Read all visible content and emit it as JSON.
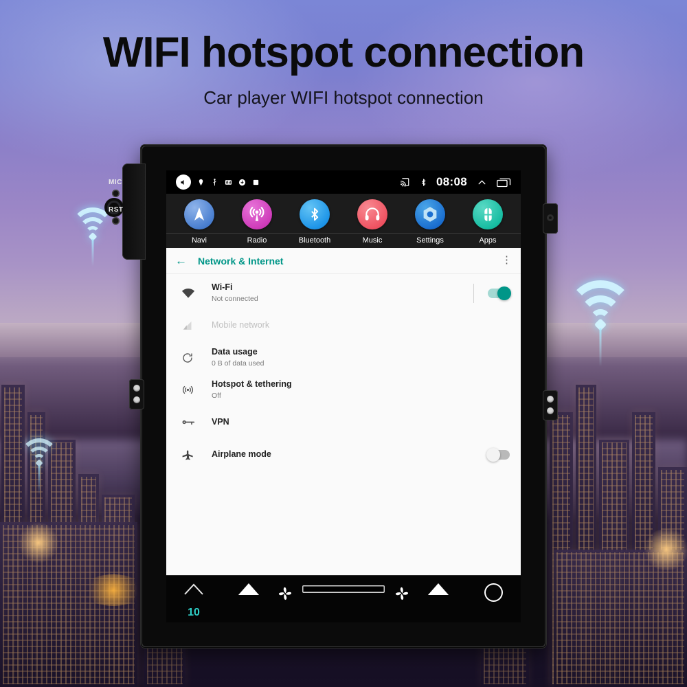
{
  "page": {
    "title": "WIFI hotspot connection",
    "subtitle": "Car player WIFI hotspot connection"
  },
  "device": {
    "left_ports": [
      {
        "label": "MIC",
        "icon": "microphone-jack-icon"
      },
      {
        "label": "RST",
        "icon": "reset-button-icon"
      }
    ]
  },
  "status_bar": {
    "left_icons": [
      "volume-mute-icon",
      "location-icon",
      "usb-icon",
      "equalizer-icon",
      "download-icon",
      "stop-square-icon"
    ],
    "right_icons": [
      "cast-icon",
      "bluetooth-icon"
    ],
    "time": "08:08",
    "chevron_icon": "chevron-up-icon",
    "recents_icon": "recents-icon"
  },
  "dock": {
    "items": [
      {
        "label": "Navi",
        "icon": "navigation-arrow-icon"
      },
      {
        "label": "Radio",
        "icon": "radio-antenna-icon"
      },
      {
        "label": "Bluetooth",
        "icon": "bluetooth-icon"
      },
      {
        "label": "Music",
        "icon": "headphones-icon"
      },
      {
        "label": "Settings",
        "icon": "settings-gear-icon"
      },
      {
        "label": "Apps",
        "icon": "apps-grid-icon"
      }
    ]
  },
  "settings": {
    "back_icon": "back-arrow-icon",
    "title": "Network & Internet",
    "overflow_icon": "more-vertical-icon",
    "rows": [
      {
        "id": "wifi",
        "icon": "wifi-icon",
        "title": "Wi-Fi",
        "subtitle": "Not connected",
        "control": "switch",
        "switch_state": "on",
        "disabled": false,
        "has_divider": true
      },
      {
        "id": "mobile-network",
        "icon": "signal-cellular-icon",
        "title": "Mobile network",
        "subtitle": "",
        "control": "none",
        "switch_state": "",
        "disabled": true,
        "has_divider": false
      },
      {
        "id": "data-usage",
        "icon": "data-usage-icon",
        "title": "Data usage",
        "subtitle": "0 B of data used",
        "control": "none",
        "switch_state": "",
        "disabled": false,
        "has_divider": false
      },
      {
        "id": "hotspot-tethering",
        "icon": "hotspot-icon",
        "title": "Hotspot & tethering",
        "subtitle": "Off",
        "control": "none",
        "switch_state": "",
        "disabled": false,
        "has_divider": false
      },
      {
        "id": "vpn",
        "icon": "vpn-key-icon",
        "title": "VPN",
        "subtitle": "",
        "control": "none",
        "switch_state": "",
        "disabled": false,
        "has_divider": false
      },
      {
        "id": "airplane-mode",
        "icon": "airplane-icon",
        "title": "Airplane mode",
        "subtitle": "",
        "control": "switch",
        "switch_state": "off",
        "disabled": false,
        "has_divider": false
      }
    ]
  },
  "control_bar": {
    "volume_value": "10",
    "left_stepper": {
      "up_icon": "chevron-up-outline-icon",
      "down_icon": "chevron-down-outline-icon"
    },
    "temp_left_stepper": {
      "up_icon": "triangle-up-icon",
      "down_icon": "triangle-down-icon"
    },
    "fan_left_icon": "fan-icon",
    "fan_right_icon": "fan-icon",
    "slider_value": 0,
    "temp_right_stepper": {
      "up_icon": "triangle-up-icon",
      "down_icon": "triangle-down-icon"
    },
    "home_icon": "home-circle-icon",
    "back_icon": "back-triangle-icon"
  },
  "colors": {
    "accent_teal": "#009688",
    "volume_value": "#2fd0c8",
    "screen_bg": "#fafafa",
    "bezel": "#0b0b0b"
  }
}
